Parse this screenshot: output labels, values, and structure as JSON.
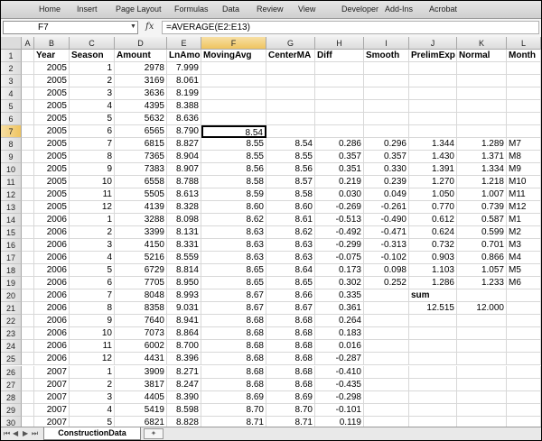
{
  "ribbon_tabs": [
    "Home",
    "Insert",
    "Page Layout",
    "Formulas",
    "Data",
    "Review",
    "View",
    "Developer",
    "Add-Ins",
    "Acrobat"
  ],
  "name_box": "F7",
  "fx_symbol": "fx",
  "formula": "=AVERAGE(E2:E13)",
  "active_cell": "F7",
  "columns": [
    "A",
    "B",
    "C",
    "D",
    "E",
    "F",
    "G",
    "H",
    "I",
    "J",
    "K",
    "L"
  ],
  "headers": [
    "Year",
    "Season",
    "Amount",
    "LnAmount",
    "MovingAvg",
    "CenterMA",
    "Diff",
    "Smooth",
    "PrelimExp",
    "Normal",
    "Month"
  ],
  "rows": [
    [
      "2005",
      "1",
      "2978",
      "7.999",
      "",
      "",
      "",
      "",
      "",
      "",
      ""
    ],
    [
      "2005",
      "2",
      "3169",
      "8.061",
      "",
      "",
      "",
      "",
      "",
      "",
      ""
    ],
    [
      "2005",
      "3",
      "3636",
      "8.199",
      "",
      "",
      "",
      "",
      "",
      "",
      ""
    ],
    [
      "2005",
      "4",
      "4395",
      "8.388",
      "",
      "",
      "",
      "",
      "",
      "",
      ""
    ],
    [
      "2005",
      "5",
      "5632",
      "8.636",
      "",
      "",
      "",
      "",
      "",
      "",
      ""
    ],
    [
      "2005",
      "6",
      "6565",
      "8.790",
      "8.54",
      "",
      "",
      "",
      "",
      "",
      ""
    ],
    [
      "2005",
      "7",
      "6815",
      "8.827",
      "8.55",
      "8.54",
      "0.286",
      "0.296",
      "1.344",
      "1.289",
      "M7"
    ],
    [
      "2005",
      "8",
      "7365",
      "8.904",
      "8.55",
      "8.55",
      "0.357",
      "0.357",
      "1.430",
      "1.371",
      "M8"
    ],
    [
      "2005",
      "9",
      "7383",
      "8.907",
      "8.56",
      "8.56",
      "0.351",
      "0.330",
      "1.391",
      "1.334",
      "M9"
    ],
    [
      "2005",
      "10",
      "6558",
      "8.788",
      "8.58",
      "8.57",
      "0.219",
      "0.239",
      "1.270",
      "1.218",
      "M10"
    ],
    [
      "2005",
      "11",
      "5505",
      "8.613",
      "8.59",
      "8.58",
      "0.030",
      "0.049",
      "1.050",
      "1.007",
      "M11"
    ],
    [
      "2005",
      "12",
      "4139",
      "8.328",
      "8.60",
      "8.60",
      "-0.269",
      "-0.261",
      "0.770",
      "0.739",
      "M12"
    ],
    [
      "2006",
      "1",
      "3288",
      "8.098",
      "8.62",
      "8.61",
      "-0.513",
      "-0.490",
      "0.612",
      "0.587",
      "M1"
    ],
    [
      "2006",
      "2",
      "3399",
      "8.131",
      "8.63",
      "8.62",
      "-0.492",
      "-0.471",
      "0.624",
      "0.599",
      "M2"
    ],
    [
      "2006",
      "3",
      "4150",
      "8.331",
      "8.63",
      "8.63",
      "-0.299",
      "-0.313",
      "0.732",
      "0.701",
      "M3"
    ],
    [
      "2006",
      "4",
      "5216",
      "8.559",
      "8.63",
      "8.63",
      "-0.075",
      "-0.102",
      "0.903",
      "0.866",
      "M4"
    ],
    [
      "2006",
      "5",
      "6729",
      "8.814",
      "8.65",
      "8.64",
      "0.173",
      "0.098",
      "1.103",
      "1.057",
      "M5"
    ],
    [
      "2006",
      "6",
      "7705",
      "8.950",
      "8.65",
      "8.65",
      "0.302",
      "0.252",
      "1.286",
      "1.233",
      "M6"
    ],
    [
      "2006",
      "7",
      "8048",
      "8.993",
      "8.67",
      "8.66",
      "0.335",
      "",
      "sum",
      "",
      ""
    ],
    [
      "2006",
      "8",
      "8358",
      "9.031",
      "8.67",
      "8.67",
      "0.361",
      "",
      "12.515",
      "12.000",
      ""
    ],
    [
      "2006",
      "9",
      "7640",
      "8.941",
      "8.68",
      "8.68",
      "0.264",
      "",
      "",
      "",
      ""
    ],
    [
      "2006",
      "10",
      "7073",
      "8.864",
      "8.68",
      "8.68",
      "0.183",
      "",
      "",
      "",
      ""
    ],
    [
      "2006",
      "11",
      "6002",
      "8.700",
      "8.68",
      "8.68",
      "0.016",
      "",
      "",
      "",
      ""
    ],
    [
      "2006",
      "12",
      "4431",
      "8.396",
      "8.68",
      "8.68",
      "-0.287",
      "",
      "",
      "",
      ""
    ],
    [
      "2007",
      "1",
      "3909",
      "8.271",
      "8.68",
      "8.68",
      "-0.410",
      "",
      "",
      "",
      ""
    ],
    [
      "2007",
      "2",
      "3817",
      "8.247",
      "8.68",
      "8.68",
      "-0.435",
      "",
      "",
      "",
      ""
    ],
    [
      "2007",
      "3",
      "4405",
      "8.390",
      "8.69",
      "8.69",
      "-0.298",
      "",
      "",
      "",
      ""
    ],
    [
      "2007",
      "4",
      "5419",
      "8.598",
      "8.70",
      "8.70",
      "-0.101",
      "",
      "",
      "",
      ""
    ],
    [
      "2007",
      "5",
      "6821",
      "8.828",
      "8.71",
      "8.71",
      "0.119",
      "",
      "",
      "",
      ""
    ]
  ],
  "row_numbers": [
    "1",
    "2",
    "3",
    "4",
    "5",
    "6",
    "7",
    "8",
    "9",
    "10",
    "11",
    "12",
    "13",
    "14",
    "15",
    "16",
    "17",
    "18",
    "19",
    "20",
    "21",
    "22",
    "23",
    "24",
    "25",
    "26",
    "27",
    "28",
    "29",
    "30"
  ],
  "sheet_tab": "ConstructionData",
  "sheet_nav": [
    "⏮",
    "◀",
    "▶",
    "⏭"
  ],
  "new_sheet_icon": "✦"
}
